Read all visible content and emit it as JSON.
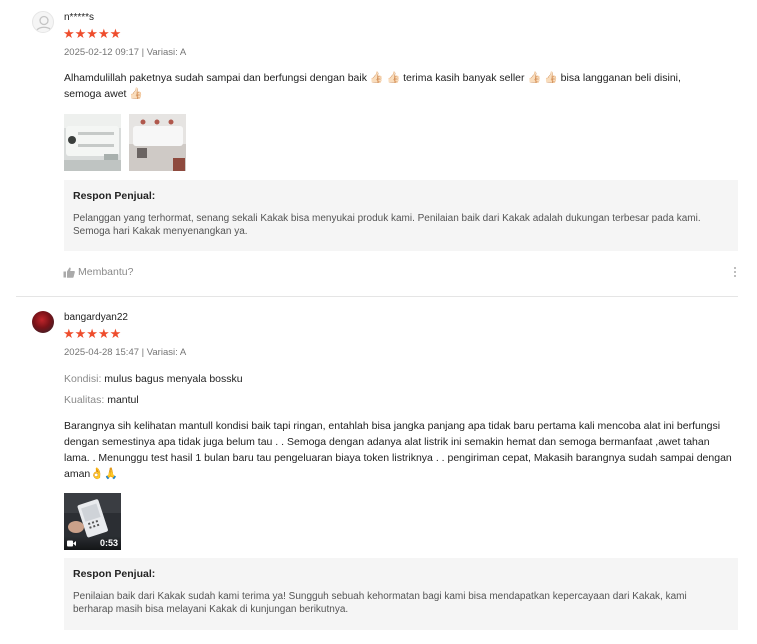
{
  "reviews": [
    {
      "username": "n*****s",
      "stars": "★★★★★",
      "meta": "2025-02-12 09:17 | Variasi: A",
      "text_parts": [
        "Alhamdulillah paketnya sudah sampai dan berfungsi dengan baik ",
        " terima kasih banyak seller ",
        " bisa langganan beli disini,",
        "semoga awet "
      ],
      "emoji": "👍🏻",
      "reply_title": "Respon Penjual:",
      "reply_text": "Pelanggan yang terhormat, senang sekali Kakak bisa menyukai produk kami. Penilaian baik dari Kakak adalah dukungan terbesar pada kami. Semoga hari Kakak menyenangkan ya.",
      "helpful_label": "Membantu?"
    },
    {
      "username": "bangardyan22",
      "stars": "★★★★★",
      "meta": "2025-04-28 15:47 | Variasi: A",
      "attr_kondisi_key": "Kondisi:",
      "attr_kondisi_val": "mulus bagus menyala bossku",
      "attr_kualitas_key": "Kualitas:",
      "attr_kualitas_val": "mantul",
      "text": "Barangnya sih kelihatan mantull kondisi baik tapi ringan, entahlah bisa jangka panjang apa tidak baru pertama kali mencoba alat ini berfungsi dengan semestinya apa tidak juga belum tau . . Semoga dengan adanya alat listrik ini semakin hemat dan semoga bermanfaat ,awet tahan lama. . Menunggu test hasil 1 bulan baru tau pengeluaran biaya token listriknya . . pengiriman cepat, Makasih barangnya sudah sampai dengan aman",
      "emojis": "👌🙏",
      "video_duration": "0:53",
      "reply_title": "Respon Penjual:",
      "reply_text": "Penilaian baik dari Kakak sudah kami terima ya! Sungguh sebuah kehormatan bagi kami bisa mendapatkan kepercayaan dari Kakak, kami berharap masih bisa melayani Kakak di kunjungan berikutnya."
    }
  ],
  "colors": {
    "star": "#ee4d2d",
    "reply_bg": "#f5f5f5",
    "muted": "#757575"
  },
  "icons": {
    "avatar_default": "user-placeholder-icon",
    "helpful": "thumbs-up-icon",
    "more": "more-vertical-icon",
    "video": "video-camera-icon"
  }
}
